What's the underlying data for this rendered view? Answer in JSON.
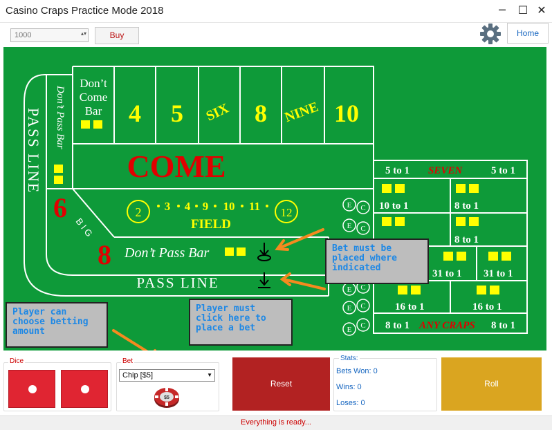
{
  "window": {
    "title": "Casino Craps Practice Mode 2018",
    "minimize": "─",
    "maximize": "☐",
    "close": "✕"
  },
  "toolbar": {
    "amount_value": "1000",
    "buy_label": "Buy",
    "home_label": "Home"
  },
  "table": {
    "dont_come_bar": [
      "Don’t",
      "Come",
      "Bar"
    ],
    "dont_pass_bar_vertical": "Don’t Pass Bar",
    "pass_line_vertical": "PASS LINE",
    "numbers": [
      "4",
      "5",
      "SIX",
      "8",
      "NINE",
      "10"
    ],
    "come": "COME",
    "field_numbers": [
      "2",
      "3",
      "4",
      "9",
      "10",
      "11",
      "12"
    ],
    "field_label": "FIELD",
    "big_six": "6",
    "big_eight": "8",
    "big_label": "B I G",
    "dont_pass_bar": "Don’t Pass Bar",
    "pass_line": "PASS LINE",
    "ce_e": "E",
    "ce_c": "C",
    "props": {
      "seven_left": "5 to 1",
      "seven": "SEVEN",
      "seven_right": "5 to 1",
      "hard1_left": "10 to 1",
      "hard1_right": "8 to 1",
      "hard2_right": "8 to 1",
      "horn_mid": "31 to 1",
      "horn_right": "31 to 1",
      "horn_low_left": "16 to 1",
      "horn_low_right": "16 to 1",
      "anycraps_left": "8 to 1",
      "anycraps": "ANY CRAPS",
      "anycraps_right": "8 to 1"
    }
  },
  "callouts": {
    "bet_placement": "Bet must be placed where indicated",
    "betting_amount": "Player can choose betting amount",
    "click_to_bet": "Player must click here to place a bet"
  },
  "panel": {
    "dice_label": "Dice",
    "bet_label": "Bet",
    "chip_select": "Chip [$5]",
    "chip_value": "$5",
    "reset_label": "Reset",
    "stats_label": "Stats:",
    "bets_won": "Bets Won: 0",
    "wins": "Wins: 0",
    "loses": "Loses: 0",
    "roll_label": "Roll"
  },
  "status": {
    "message": "Everything is ready..."
  },
  "colors": {
    "felt": "#0e9a39",
    "accent_yellow": "#ffff00",
    "red": "#e00000",
    "reset": "#b22222",
    "roll": "#daa520"
  }
}
